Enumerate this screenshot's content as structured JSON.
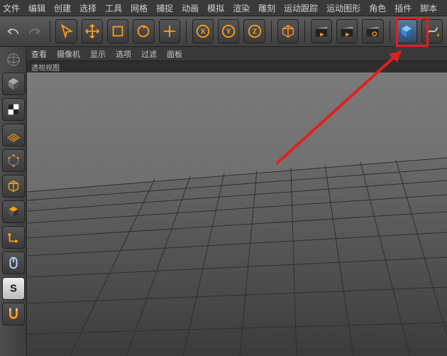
{
  "menubar": {
    "items": [
      "文件",
      "编辑",
      "创建",
      "选择",
      "工具",
      "网格",
      "捕捉",
      "动画",
      "模拟",
      "渲染",
      "雕刻",
      "运动跟踪",
      "运动图形",
      "角色",
      "插件",
      "脚本"
    ]
  },
  "toolbar": {
    "undo_icon": "undo-icon",
    "redo_icon": "redo-icon"
  },
  "view_menubar": {
    "items": [
      "查看",
      "摄像机",
      "显示",
      "选项",
      "过滤",
      "面板"
    ]
  },
  "viewport_label": "透视视图",
  "colors": {
    "highlight": "#e02020",
    "accent_orange": "#ff9c1a",
    "accent_blue": "#3aa0ff"
  }
}
